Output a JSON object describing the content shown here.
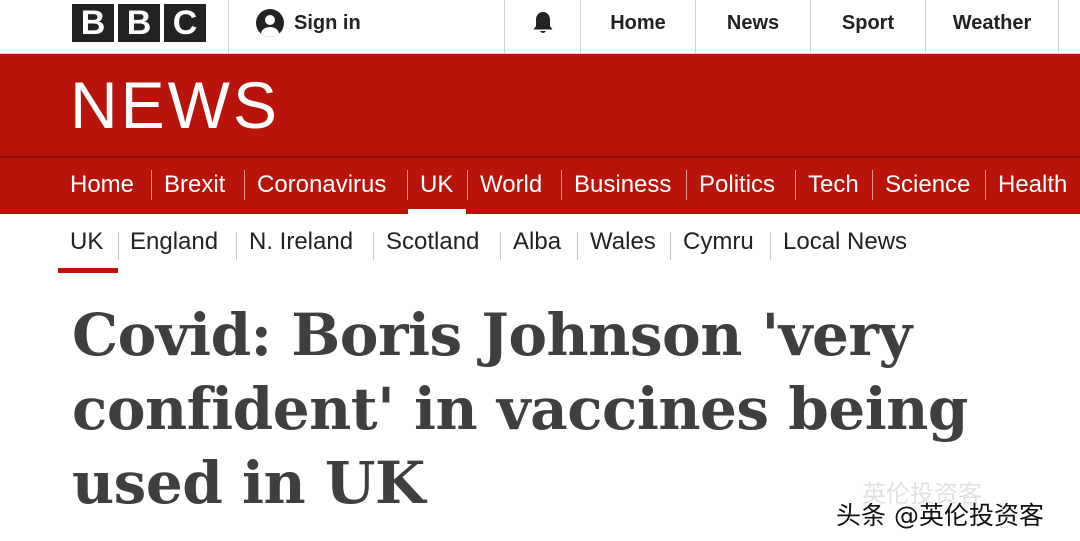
{
  "header": {
    "logo_letters": [
      "B",
      "B",
      "C"
    ],
    "signin_label": "Sign in",
    "notification_icon": "bell-icon",
    "links": [
      "Home",
      "News",
      "Sport",
      "Weather"
    ]
  },
  "masthead": {
    "title": "NEWS",
    "background_color": "#b8140b"
  },
  "main_nav": {
    "items": [
      "Home",
      "Brexit",
      "Coronavirus",
      "UK",
      "World",
      "Business",
      "Politics",
      "Tech",
      "Science",
      "Health"
    ],
    "active": "UK"
  },
  "sub_nav": {
    "items": [
      "UK",
      "England",
      "N. Ireland",
      "Scotland",
      "Alba",
      "Wales",
      "Cymru",
      "Local News"
    ],
    "active": "UK"
  },
  "article": {
    "headline": "Covid: Boris Johnson 'very confident' in vaccines being used in UK"
  },
  "watermark": {
    "ghost_text": "英伦投资客",
    "text": "头条 @英伦投资客"
  }
}
